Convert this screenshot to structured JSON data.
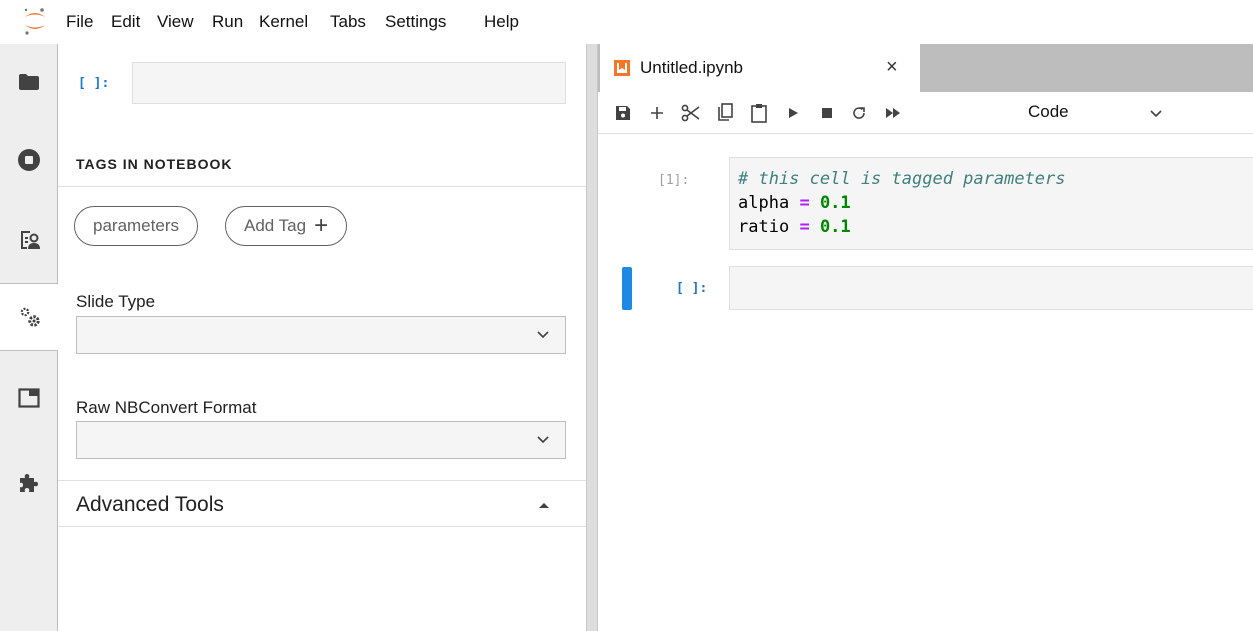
{
  "menu": [
    "File",
    "Edit",
    "View",
    "Run",
    "Kernel",
    "Tabs",
    "Settings",
    "Help"
  ],
  "colors": {
    "accent": "#1976d2",
    "jupyter_orange": "#f37726",
    "cell_active": "#1e88e5"
  },
  "sidebar": {
    "icons": [
      "folder-icon",
      "stop-circle-icon",
      "command-palette-icon",
      "gears-icon",
      "tab-window-icon",
      "extension-puzzle-icon"
    ],
    "active": "gears-icon"
  },
  "inspector": {
    "metadata_prompt": "[ ]:",
    "tags_heading": "TAGS IN NOTEBOOK",
    "tags": [
      "parameters"
    ],
    "add_tag_label": "Add Tag",
    "add_tag_icon": "+",
    "slide_type_label": "Slide Type",
    "slide_type_value": "",
    "raw_format_label": "Raw NBConvert Format",
    "raw_format_value": "",
    "advanced_tools_label": "Advanced Tools"
  },
  "notebook": {
    "tab_title": "Untitled.ipynb",
    "tab_close": "×",
    "cell_type": "Code",
    "cells": [
      {
        "prompt": "[1]:",
        "lines": [
          {
            "comment": "# this cell is tagged parameters"
          },
          {
            "name": "alpha",
            "op": "=",
            "value": "0.1"
          },
          {
            "name": "ratio",
            "op": "=",
            "value": "0.1"
          }
        ]
      },
      {
        "prompt": "[ ]:",
        "lines": []
      }
    ]
  }
}
